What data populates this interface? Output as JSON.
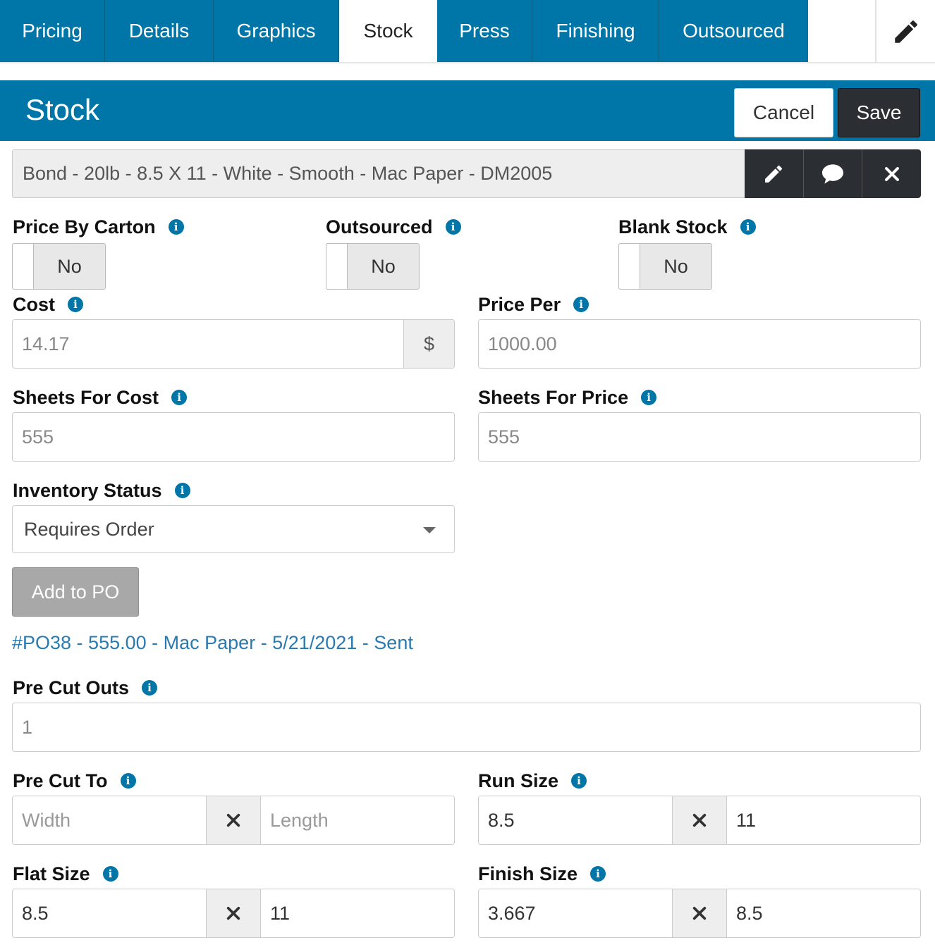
{
  "tabs": [
    {
      "label": "Pricing",
      "active": false
    },
    {
      "label": "Details",
      "active": false
    },
    {
      "label": "Graphics",
      "active": false
    },
    {
      "label": "Stock",
      "active": true
    },
    {
      "label": "Press",
      "active": false
    },
    {
      "label": "Finishing",
      "active": false
    },
    {
      "label": "Outsourced",
      "active": false
    }
  ],
  "header": {
    "title": "Stock",
    "cancel_label": "Cancel",
    "save_label": "Save"
  },
  "stock": {
    "description": "Bond - 20lb - 8.5 X 11 - White - Smooth - Mac Paper - DM2005"
  },
  "toggles": {
    "price_by_carton": {
      "label": "Price By Carton",
      "value": "No"
    },
    "outsourced": {
      "label": "Outsourced",
      "value": "No"
    },
    "blank_stock": {
      "label": "Blank Stock",
      "value": "No"
    }
  },
  "fields": {
    "cost": {
      "label": "Cost",
      "value": "14.17",
      "addon": "$"
    },
    "price_per": {
      "label": "Price Per",
      "value": "1000.00"
    },
    "sheets_for_cost": {
      "label": "Sheets For Cost",
      "value": "555"
    },
    "sheets_for_price": {
      "label": "Sheets For Price",
      "value": "555"
    },
    "inventory_status": {
      "label": "Inventory Status",
      "value": "Requires Order"
    },
    "pre_cut_outs": {
      "label": "Pre Cut Outs",
      "value": "1"
    },
    "pre_cut_to": {
      "label": "Pre Cut To",
      "width_placeholder": "Width",
      "length_placeholder": "Length"
    },
    "run_size": {
      "label": "Run Size",
      "width": "8.5",
      "length": "11"
    },
    "flat_size": {
      "label": "Flat Size",
      "width": "8.5",
      "length": "11"
    },
    "finish_size": {
      "label": "Finish Size",
      "width": "3.667",
      "length": "8.5"
    }
  },
  "po": {
    "button_label": "Add to PO",
    "link_text": "#PO38 - 555.00 - Mac Paper - 5/21/2021 - Sent"
  },
  "info_glyph": "i",
  "colors": {
    "primary": "#0076a8",
    "dark_button": "#2b2f33",
    "link": "#2a7ab0"
  }
}
